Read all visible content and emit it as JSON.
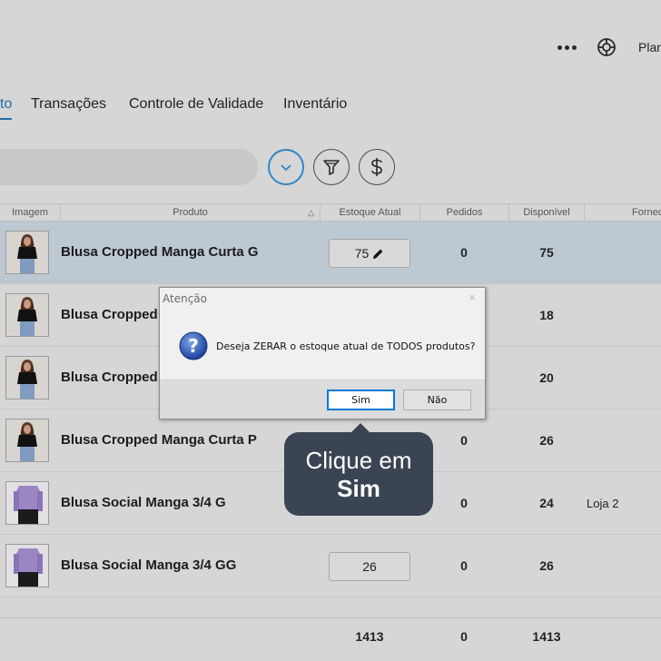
{
  "header": {
    "more_icon": "more-dots-icon",
    "help_icon": "lifebuoy-icon",
    "plan_label": "Plan"
  },
  "tabs": [
    {
      "label": "to",
      "active": true
    },
    {
      "label": "Transações",
      "active": false
    },
    {
      "label": "Controle de Validade",
      "active": false
    },
    {
      "label": "Inventário",
      "active": false
    }
  ],
  "toolbar": {
    "expand_icon": "chevron-down-icon",
    "filter_icon": "filter-icon",
    "price_icon": "dollar-icon"
  },
  "table": {
    "columns": [
      "Imagem",
      "Produto",
      "Estoque Atual",
      "Pedidos",
      "Disponível",
      "Forneced"
    ],
    "sort_indicator": "△",
    "rows": [
      {
        "produto": "Blusa Cropped Manga Curta G",
        "estoque": "75",
        "pedidos": "0",
        "disponivel": "75",
        "fornecedor": "",
        "selected": true,
        "thumb": "black-top"
      },
      {
        "produto": "Blusa Cropped",
        "estoque": "",
        "pedidos": "",
        "disponivel": "18",
        "fornecedor": "",
        "selected": false,
        "thumb": "black-top"
      },
      {
        "produto": "Blusa Cropped",
        "estoque": "",
        "pedidos": "",
        "disponivel": "20",
        "fornecedor": "",
        "selected": false,
        "thumb": "black-top"
      },
      {
        "produto": "Blusa Cropped Manga Curta P",
        "estoque": "",
        "pedidos": "0",
        "disponivel": "26",
        "fornecedor": "",
        "selected": false,
        "thumb": "black-top"
      },
      {
        "produto": "Blusa Social Manga 3/4 G",
        "estoque": "",
        "pedidos": "0",
        "disponivel": "24",
        "fornecedor": "Loja 2",
        "selected": false,
        "thumb": "lilac-shirt"
      },
      {
        "produto": "Blusa Social Manga 3/4 GG",
        "estoque": "26",
        "pedidos": "0",
        "disponivel": "26",
        "fornecedor": "",
        "selected": false,
        "thumb": "lilac-shirt"
      }
    ],
    "totals": {
      "estoque": "1413",
      "pedidos": "0",
      "disponivel": "1413"
    }
  },
  "dialog": {
    "title": "Atenção",
    "close": "×",
    "message": "Deseja ZERAR o estoque atual de TODOS produtos?",
    "yes_label": "Sim",
    "no_label": "Não",
    "icon": "question-icon"
  },
  "tooltip": {
    "line1": "Clique em",
    "line2": "Sim"
  },
  "colors": {
    "accent": "#2e86c8",
    "selected_row": "#bdc9d2",
    "tooltip_bg": "#3a4452"
  }
}
